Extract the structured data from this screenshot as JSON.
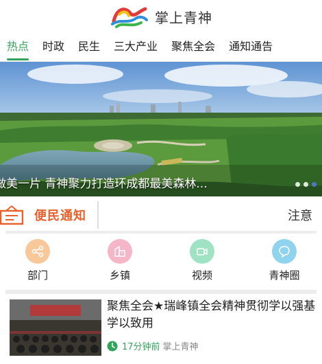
{
  "header": {
    "title": "掌上青神",
    "logo_icon": "colorful-ribbon-logo"
  },
  "tabs": [
    {
      "label": "热点",
      "active": true
    },
    {
      "label": "时政"
    },
    {
      "label": "民生"
    },
    {
      "label": "三大产业"
    },
    {
      "label": "聚焦全会"
    },
    {
      "label": "通知通告"
    }
  ],
  "banner": {
    "caption": "做美一片 青神聚力打造环成都最美森林...",
    "slide_count": 3,
    "active_slide": 3
  },
  "notice": {
    "label": "便民通知",
    "text": "注意",
    "accent_color": "#e8602c"
  },
  "quick_links": [
    {
      "label": "部门",
      "icon": "share-nodes-icon",
      "color": "#f8c89a"
    },
    {
      "label": "乡镇",
      "icon": "building-icon",
      "color": "#f5b6c8"
    },
    {
      "label": "视频",
      "icon": "video-camera-icon",
      "color": "#9fe3c4"
    },
    {
      "label": "青神圈",
      "icon": "chat-bubble-icon",
      "color": "#8fd3ee"
    }
  ],
  "news": [
    {
      "title": "聚焦全会★瑞峰镇全会精神贯彻学以强基 学以致用",
      "time": "17分钟前",
      "source": "掌上青神"
    }
  ],
  "colors": {
    "accent_green": "#34a45c"
  }
}
